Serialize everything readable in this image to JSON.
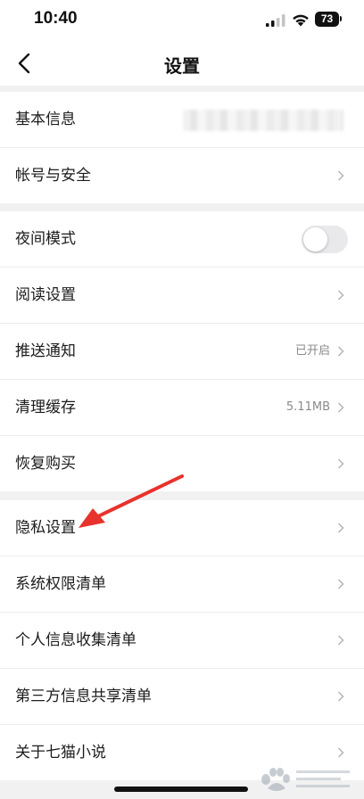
{
  "status_bar": {
    "time": "10:40",
    "battery": "73"
  },
  "nav": {
    "title": "设置"
  },
  "groups": [
    {
      "items": [
        {
          "label": "基本信息"
        },
        {
          "label": "帐号与安全"
        }
      ]
    },
    {
      "items": [
        {
          "label": "夜间模式",
          "toggle": false
        },
        {
          "label": "阅读设置"
        },
        {
          "label": "推送通知",
          "value": "已开启"
        },
        {
          "label": "清理缓存",
          "value": "5.11MB"
        },
        {
          "label": "恢复购买"
        }
      ]
    },
    {
      "items": [
        {
          "label": "隐私设置"
        },
        {
          "label": "系统权限清单"
        },
        {
          "label": "个人信息收集清单"
        },
        {
          "label": "第三方信息共享清单"
        },
        {
          "label": "关于七猫小说"
        }
      ]
    }
  ],
  "colors": {
    "annotation_arrow": "#e8322c",
    "background": "#f1f1f1"
  },
  "icons": {
    "back": "chevron-left-icon",
    "row": "chevron-right-icon"
  }
}
